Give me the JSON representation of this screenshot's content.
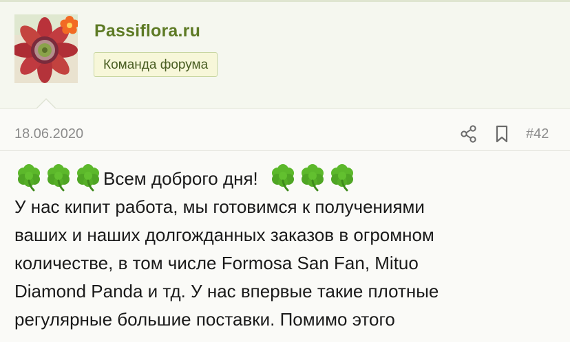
{
  "user": {
    "name": "Passiflora.ru",
    "role": "Команда форума"
  },
  "post": {
    "date": "18.06.2020",
    "number": "#42",
    "greeting": "Всем доброго дня!",
    "lines": [
      "У нас кипит работа, мы готовимся к получениями",
      "ваших и наших долгожданных заказов в огромном",
      "количестве, в том числе Formosa San Fan, Mituo",
      "Diamond Panda и тд. У нас впервые такие плотные",
      "регулярные большие поставки. Помимо этого"
    ]
  },
  "icons": {
    "share": "share-icon",
    "bookmark": "bookmark-icon",
    "clover": "shamrock-emoji"
  },
  "colors": {
    "username": "#5d7a24",
    "badge_bg": "#f7f7d9",
    "badge_border": "#c8d6a0",
    "meta_text": "#8c8c8c",
    "clover": "#5cb82b"
  }
}
